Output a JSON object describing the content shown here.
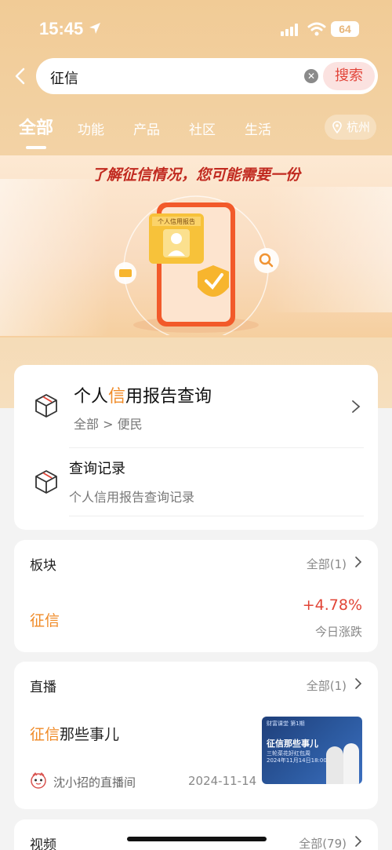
{
  "status_bar": {
    "time": "15:45",
    "battery": "64"
  },
  "search": {
    "query": "征信",
    "button": "搜索"
  },
  "tabs": [
    {
      "label": "全部"
    },
    {
      "label": "功能"
    },
    {
      "label": "产品"
    },
    {
      "label": "社区"
    },
    {
      "label": "生活"
    }
  ],
  "city": "杭州",
  "banner": {
    "title": "了解征信情况，您可能需要一份",
    "doc_label": "个人信用报告"
  },
  "services": {
    "item1": {
      "title_pre": "个人",
      "title_hl": "信",
      "title_post": "用报告查询",
      "sub": "全部 > 便民"
    },
    "item2": {
      "title": "查询记录",
      "sub": "个人信用报告查询记录"
    }
  },
  "plate": {
    "header": "板块",
    "more": "全部(1)",
    "name": "征信",
    "change": "+4.78%",
    "change_label": "今日涨跌"
  },
  "live": {
    "header": "直播",
    "more": "全部(1)",
    "title_hl": "征信",
    "title_rest": "那些事儿",
    "host": "沈小招的直播间",
    "date": "2024-11-14",
    "thumb": {
      "tag": "财富课堂 第1期",
      "title": "征信那些事儿",
      "sub": "三轮菜花好红包周",
      "date": "2024年11月14日18:00开播"
    }
  },
  "video": {
    "header": "视频",
    "more": "全部(79)"
  },
  "colors": {
    "accent": "#f08a26",
    "up": "#e14436",
    "header_bg": "#f1cb96"
  }
}
